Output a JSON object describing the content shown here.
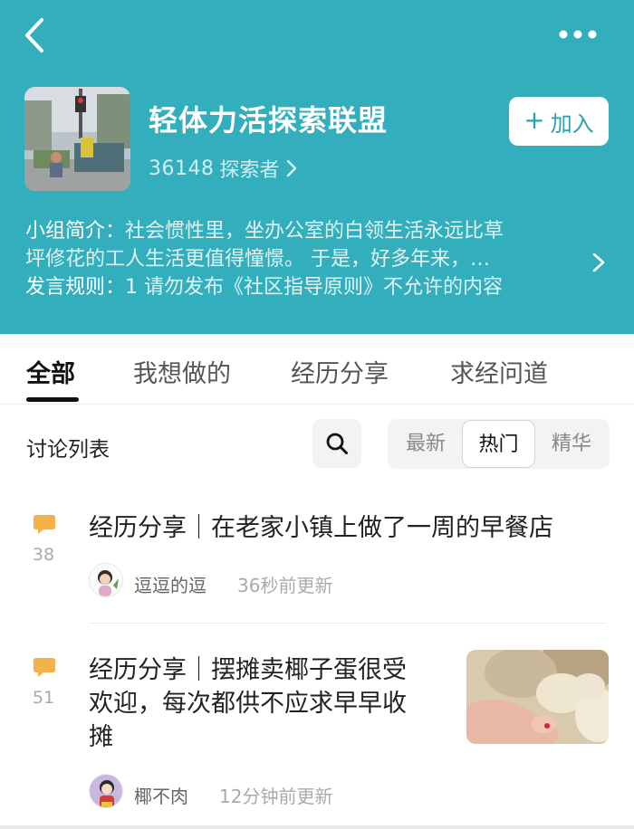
{
  "group": {
    "name": "轻体力活探索联盟",
    "member_count": "36148",
    "member_label": "探索者",
    "join_label": "加入",
    "join_plus": "+",
    "intro_label": "小组简介：",
    "intro_line1": "社会惯性里，坐办公室的白领生活永远比草",
    "intro_line2": "坪修花的工人生活更值得憧憬。 于是，好多年来，…",
    "rules_label": "发言规则：",
    "rules_text": "1 请勿发布《社区指导原则》不允许的内容"
  },
  "tabs": [
    "全部",
    "我想做的",
    "经历分享",
    "求经问道"
  ],
  "list": {
    "title": "讨论列表",
    "sort_options": [
      "最新",
      "热门",
      "精华"
    ],
    "active_sort": "热门"
  },
  "posts": [
    {
      "comments": "38",
      "title": "经历分享｜在老家小镇上做了一周的早餐店",
      "author": "逗逗的逗",
      "updated": "36秒前更新"
    },
    {
      "comments": "51",
      "title_line1": "经历分享｜摆摊卖椰子蛋很受",
      "title_line2": "欢迎，每次都供不应求早早收",
      "title_line3": "摊",
      "author": "椰不肉",
      "updated": "12分钟前更新"
    }
  ],
  "icons": {
    "back": "chevron-left-icon",
    "more": "more-dots-icon",
    "search": "search-icon",
    "comment": "comment-bubble-icon"
  },
  "colors": {
    "header_bg": "#33aebd",
    "accent": "#2f9fae",
    "comment_icon": "#f4b24b"
  }
}
